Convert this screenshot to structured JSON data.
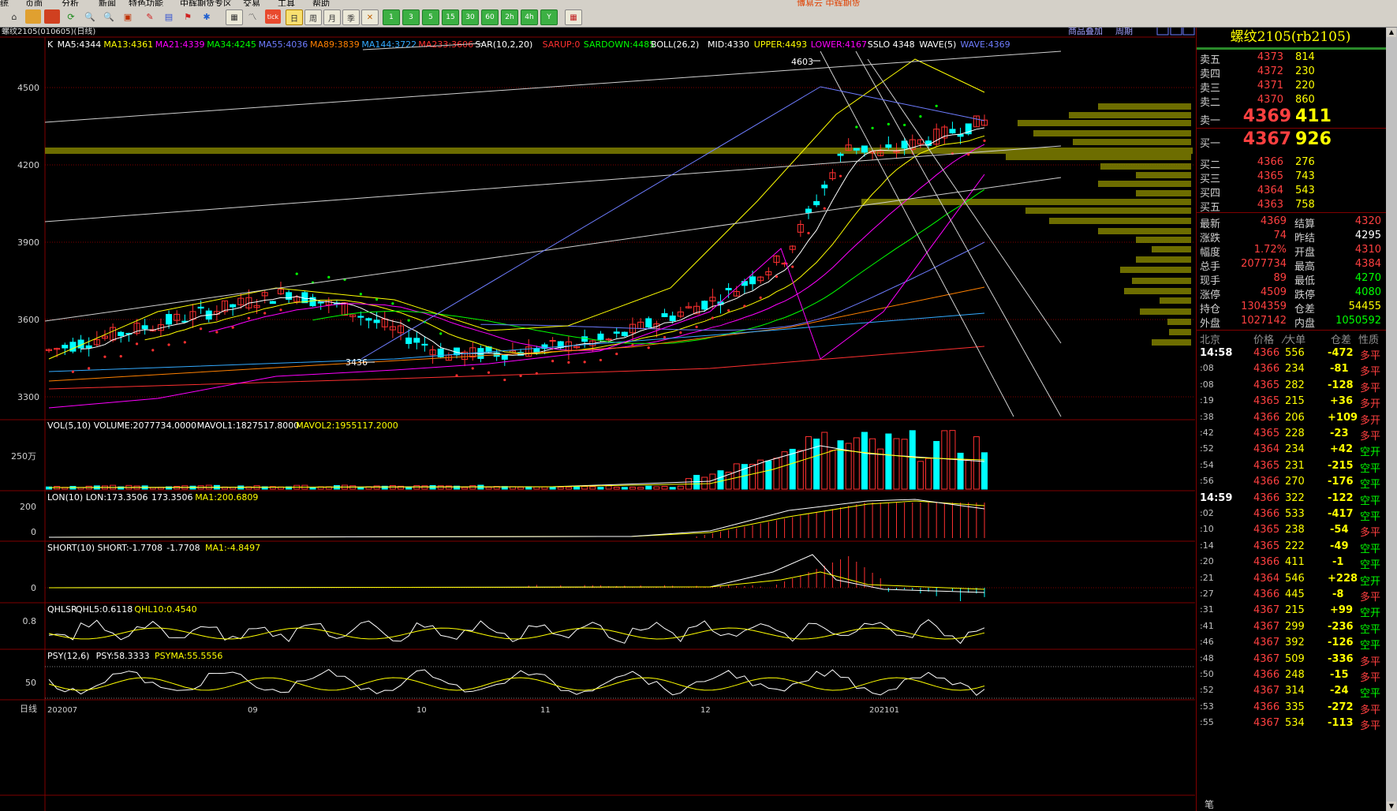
{
  "menu": [
    "统",
    "页面",
    "分析",
    "特色功能",
    "新闻",
    "中辉期货专区",
    "交易",
    "工具",
    "帮助"
  ],
  "menu_broker": "博易云 中辉期货",
  "toolbar_text": [
    "日",
    "周",
    "月",
    "季",
    "1",
    "3",
    "5",
    "15",
    "30",
    "60",
    "2h",
    "4h",
    "Y"
  ],
  "chart_header": {
    "title": "螺纹2105(010605)(日线)",
    "right_links": [
      "商品叠加",
      "周期"
    ],
    "indicator_line": [
      {
        "t": "K",
        "c": "#ffffff"
      },
      {
        "t": "MA5:4344",
        "c": "#ffffff"
      },
      {
        "t": "MA13:4361",
        "c": "#ffff00"
      },
      {
        "t": "MA21:4339",
        "c": "#ff00ff"
      },
      {
        "t": "MA34:4245",
        "c": "#00ff00"
      },
      {
        "t": "MA55:4036",
        "c": "#6e7cff"
      },
      {
        "t": "MA89:3839",
        "c": "#ff8000"
      },
      {
        "t": "MA144:3722",
        "c": "#33aaff"
      },
      {
        "t": "MA233:3606",
        "c": "#ff3030"
      },
      {
        "t": "SAR(10,2,20)",
        "c": "#ffffff"
      },
      {
        "t": "SARUP:0",
        "c": "#ff3030"
      },
      {
        "t": "SARDOWN:4485",
        "c": "#00ff00"
      },
      {
        "t": "BOLL(26,2)",
        "c": "#ffffff"
      },
      {
        "t": "MID:4330",
        "c": "#ffffff"
      },
      {
        "t": "UPPER:4493",
        "c": "#ffff00"
      },
      {
        "t": "LOWER:4167",
        "c": "#ff00ff"
      },
      {
        "t": "SSLO 4348",
        "c": "#ffffff"
      },
      {
        "t": "WAVE(5)",
        "c": "#ffffff"
      },
      {
        "t": "WAVE:4369",
        "c": "#6e7cff"
      }
    ]
  },
  "price_axis": [
    "4500",
    "4200",
    "3900",
    "3600",
    "3300"
  ],
  "annotations": {
    "high": "4603",
    "low": "3436"
  },
  "vol_panel": {
    "label": "VOL(5,10)",
    "items": [
      {
        "t": "VOL(5,10) VOLUME:2077734.0000",
        "c": "#ffffff"
      },
      {
        "t": "MAVOL1:1827517.8000",
        "c": "#ffffff"
      },
      {
        "t": "MAVOL2:1955117.2000",
        "c": "#ffff00"
      }
    ],
    "axis": "250万"
  },
  "lon_panel": {
    "items": [
      {
        "t": "LON(10) LON:173.3506",
        "c": "#ffffff"
      },
      {
        "t": "173.3506",
        "c": "#ffffff"
      },
      {
        "t": "MA1:200.6809",
        "c": "#ffff00"
      }
    ],
    "axis": [
      "200",
      "0"
    ]
  },
  "short_panel": {
    "items": [
      {
        "t": "SHORT(10) SHORT:-1.7708",
        "c": "#ffffff"
      },
      {
        "t": "-1.7708",
        "c": "#ffffff"
      },
      {
        "t": "MA1:-4.8497",
        "c": "#ffff00"
      }
    ],
    "axis": "0"
  },
  "qhlsr_panel": {
    "items": [
      {
        "t": "QHLSR",
        "c": "#ffffff"
      },
      {
        "t": "QHL5:0.6118",
        "c": "#ffffff"
      },
      {
        "t": "QHL10:0.4540",
        "c": "#ffff00"
      }
    ],
    "axis": "0.8"
  },
  "psy_panel": {
    "items": [
      {
        "t": "PSY(12,6)",
        "c": "#ffffff"
      },
      {
        "t": "PSY:58.3333",
        "c": "#ffffff"
      },
      {
        "t": "PSYMA:55.5556",
        "c": "#ffff00"
      }
    ],
    "axis": "50"
  },
  "x_axis": {
    "period": "日线",
    "labels": [
      "202007",
      "09",
      "10",
      "11",
      "12",
      "202101"
    ]
  },
  "right_panel": {
    "title": "螺纹2105(rb2105)",
    "asks": [
      {
        "label": "卖五",
        "price": "4373",
        "vol": "814"
      },
      {
        "label": "卖四",
        "price": "4372",
        "vol": "230"
      },
      {
        "label": "卖三",
        "price": "4371",
        "vol": "220"
      },
      {
        "label": "卖二",
        "price": "4370",
        "vol": "860"
      },
      {
        "label": "卖一",
        "price": "4369",
        "vol": "411"
      }
    ],
    "bids": [
      {
        "label": "买一",
        "price": "4367",
        "vol": "926"
      },
      {
        "label": "买二",
        "price": "4366",
        "vol": "276"
      },
      {
        "label": "买三",
        "price": "4365",
        "vol": "743"
      },
      {
        "label": "买四",
        "price": "4364",
        "vol": "543"
      },
      {
        "label": "买五",
        "price": "4363",
        "vol": "758"
      }
    ],
    "stats": [
      {
        "l": "最新",
        "v": "4369",
        "l2": "结算",
        "v2": "4320",
        "c2": "#ff4040"
      },
      {
        "l": "涨跌",
        "v": "74",
        "l2": "昨结",
        "v2": "4295",
        "c2": "#ffffff"
      },
      {
        "l": "幅度",
        "v": "1.72%",
        "l2": "开盘",
        "v2": "4310",
        "c2": "#ff4040"
      },
      {
        "l": "总手",
        "v": "2077734",
        "l2": "最高",
        "v2": "4384",
        "c2": "#ff4040"
      },
      {
        "l": "现手",
        "v": "89",
        "l2": "最低",
        "v2": "4270",
        "c2": "#00ff00"
      },
      {
        "l": "涨停",
        "v": "4509",
        "l2": "跌停",
        "v2": "4080",
        "c2": "#00ff00"
      },
      {
        "l": "持仓",
        "v": "1304359",
        "l2": "仓差",
        "v2": "54455",
        "c2": "#ffff00"
      },
      {
        "l": "外盘",
        "v": "1027142",
        "l2": "内盘",
        "v2": "1050592",
        "c2": "#00ff00"
      }
    ],
    "tick_header": [
      "北京",
      "价格",
      "⁄大单",
      "仓差",
      "性质"
    ],
    "ticks": [
      {
        "t": "14:58",
        "p": "4366",
        "v": "556",
        "d": "-472",
        "n": "多平"
      },
      {
        "t": ":08",
        "p": "4366",
        "v": "234",
        "d": "-81",
        "n": "多平"
      },
      {
        "t": ":08",
        "p": "4365",
        "v": "282",
        "d": "-128",
        "n": "多平"
      },
      {
        "t": ":19",
        "p": "4365",
        "v": "215",
        "d": "+36",
        "n": "多开"
      },
      {
        "t": ":38",
        "p": "4366",
        "v": "206",
        "d": "+109",
        "n": "多开"
      },
      {
        "t": ":42",
        "p": "4365",
        "v": "228",
        "d": "-23",
        "n": "多平"
      },
      {
        "t": ":52",
        "p": "4364",
        "v": "234",
        "d": "+42",
        "n": "空开"
      },
      {
        "t": ":54",
        "p": "4365",
        "v": "231",
        "d": "-215",
        "n": "空平"
      },
      {
        "t": ":56",
        "p": "4366",
        "v": "270",
        "d": "-176",
        "n": "空平"
      },
      {
        "t": "14:59",
        "p": "4366",
        "v": "322",
        "d": "-122",
        "n": "空平"
      },
      {
        "t": ":02",
        "p": "4366",
        "v": "533",
        "d": "-417",
        "n": "空平"
      },
      {
        "t": ":10",
        "p": "4365",
        "v": "238",
        "d": "-54",
        "n": "多平"
      },
      {
        "t": ":14",
        "p": "4365",
        "v": "222",
        "d": "-49",
        "n": "空平"
      },
      {
        "t": ":20",
        "p": "4366",
        "v": "411",
        "d": "-1",
        "n": "空平"
      },
      {
        "t": ":21",
        "p": "4364",
        "v": "546",
        "d": "+228",
        "n": "空开"
      },
      {
        "t": ":27",
        "p": "4366",
        "v": "445",
        "d": "-8",
        "n": "多平"
      },
      {
        "t": ":31",
        "p": "4367",
        "v": "215",
        "d": "+99",
        "n": "空开"
      },
      {
        "t": ":41",
        "p": "4367",
        "v": "299",
        "d": "-236",
        "n": "空平"
      },
      {
        "t": ":46",
        "p": "4367",
        "v": "392",
        "d": "-126",
        "n": "空平"
      },
      {
        "t": ":48",
        "p": "4367",
        "v": "509",
        "d": "-336",
        "n": "多平"
      },
      {
        "t": ":50",
        "p": "4366",
        "v": "248",
        "d": "-15",
        "n": "多平"
      },
      {
        "t": ":52",
        "p": "4367",
        "v": "314",
        "d": "-24",
        "n": "空平"
      },
      {
        "t": ":53",
        "p": "4366",
        "v": "335",
        "d": "-272",
        "n": "多平"
      },
      {
        "t": ":55",
        "p": "4367",
        "v": "534",
        "d": "-113",
        "n": "多平"
      }
    ],
    "footer": "笔"
  },
  "colors": {
    "up": "#ff3030",
    "down": "#00ffff",
    "grid": "#800000",
    "profile": "#808000"
  }
}
